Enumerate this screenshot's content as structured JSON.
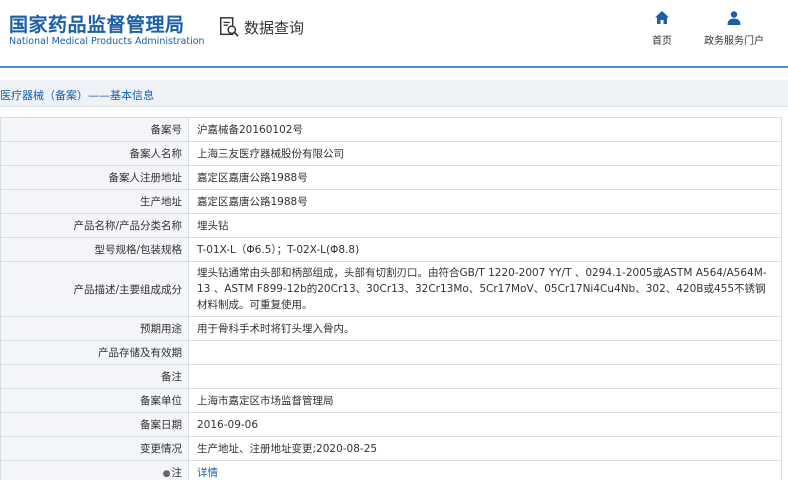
{
  "header": {
    "logo_cn": "国家药品监督管理局",
    "logo_en": "National Medical Products Administration",
    "query_label": "数据查询",
    "nav": [
      {
        "label": "首页",
        "icon": "home-icon"
      },
      {
        "label": "政务服务门户",
        "icon": "user-icon"
      }
    ]
  },
  "breadcrumb": "医疗器械（备案）——基本信息",
  "colors": {
    "brand": "#1a5fa8",
    "header_line": "#4a8fd0",
    "label_bg": "#f3f5f8",
    "border": "#d8dde3"
  },
  "rows": [
    {
      "label": "备案号",
      "value": "沪嘉械备20160102号"
    },
    {
      "label": "备案人名称",
      "value": "上海三友医疗器械股份有限公司"
    },
    {
      "label": "备案人注册地址",
      "value": "嘉定区嘉唐公路1988号"
    },
    {
      "label": "生产地址",
      "value": "嘉定区嘉唐公路1988号"
    },
    {
      "label": "产品名称/产品分类名称",
      "value": "埋头钻"
    },
    {
      "label": "型号规格/包装规格",
      "value": "T-01X-L（Φ6.5）；T-02X-L(Φ8.8)"
    },
    {
      "label": "产品描述/主要组成成分",
      "value": "埋头钻通常由头部和柄部组成，头部有切割刃口。由符合GB/T 1220-2007 YY/T 、0294.1-2005或ASTM A564/A564M-13 、ASTM F899-12b的20Cr13、30Cr13、32Cr13Mo、5Cr17MoV、05Cr17Ni4Cu4Nb、302、420B或455不锈钢材料制成。可重复使用。"
    },
    {
      "label": "预期用途",
      "value": "用于骨科手术时将钉头埋入骨内。"
    },
    {
      "label": "产品存储及有效期",
      "value": ""
    },
    {
      "label": "备注",
      "value": ""
    },
    {
      "label": "备案单位",
      "value": "上海市嘉定区市场监督管理局"
    },
    {
      "label": "备案日期",
      "value": "2016-09-06"
    },
    {
      "label": "变更情况",
      "value": "生产地址、注册地址变更;2020-08-25"
    },
    {
      "label": "注",
      "value": "详情"
    }
  ]
}
